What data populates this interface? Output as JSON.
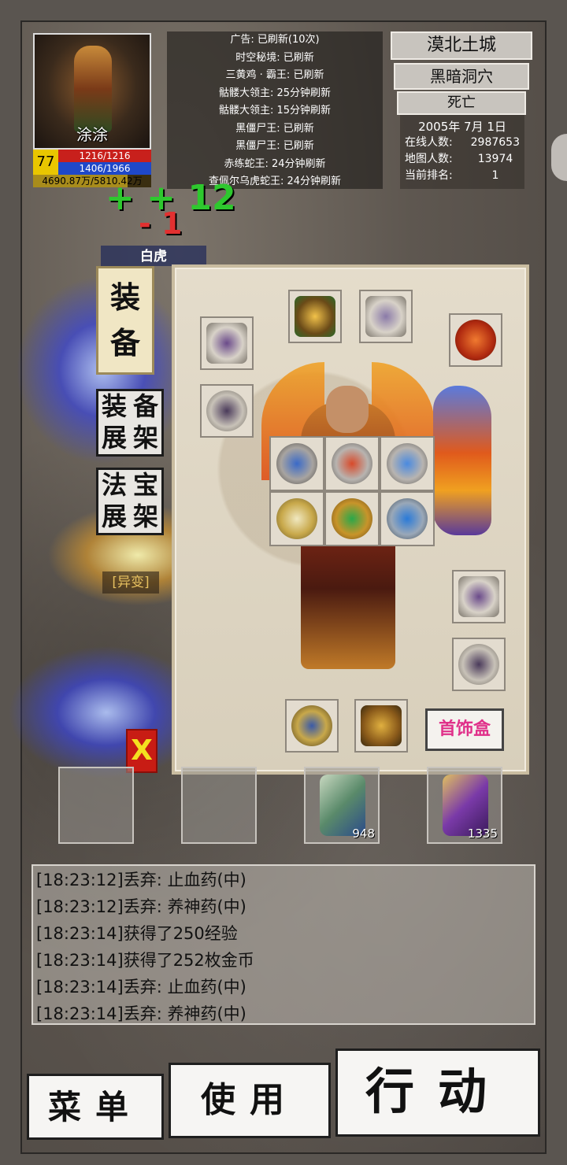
{
  "player": {
    "name": "涂涂",
    "level": "77",
    "hp": "1216/1216",
    "mp": "1406/1966",
    "exp": "4690.87万/5810.42万"
  },
  "notices": [
    "广告: 已刷新(10次)",
    "时空秘境: 已刷新",
    "三黄鸡 · 霸王: 已刷新",
    "骷髅大领主: 25分钟刷新",
    "骷髅大领主: 15分钟刷新",
    "黑僵尸王: 已刷新",
    "黑僵尸王: 已刷新",
    "赤练蛇王: 24分钟刷新",
    "查佩尔乌虎蛇王: 24分钟刷新"
  ],
  "location": {
    "region": "漠北土城",
    "map": "黑暗洞穴",
    "status": "死亡",
    "date": "2005年 7月 1日",
    "online_label": "在线人数:",
    "online_value": "2987653",
    "map_label": "地图人数:",
    "map_value": "13974",
    "rank_label": "当前排名:",
    "rank_value": "1"
  },
  "floating": {
    "heal": "+ + 12",
    "damage": "- 1"
  },
  "labels": {
    "baihu": "白虎",
    "yibian": "[异变]"
  },
  "side_tabs": {
    "equip": [
      "装",
      "备"
    ],
    "equip_rack": [
      "装",
      "备",
      "展",
      "架"
    ],
    "treasure_rack": [
      "法",
      "宝",
      "展",
      "架"
    ]
  },
  "panel": {
    "jewelry_box": "首饰盒",
    "close": "X"
  },
  "quick_slots": [
    {
      "count": ""
    },
    {
      "count": ""
    },
    {
      "count": "948"
    },
    {
      "count": "1335"
    }
  ],
  "log": [
    "[18:23:12]丢弃: 止血药(中)",
    "[18:23:12]丢弃: 养神药(中)",
    "[18:23:14]获得了250经验",
    "[18:23:14]获得了252枚金币",
    "[18:23:14]丢弃: 止血药(中)",
    "[18:23:14]丢弃: 养神药(中)"
  ],
  "buttons": {
    "menu": "菜单",
    "use": "使用",
    "action": "行动"
  },
  "colors": {
    "hp": "#c8201c",
    "mp": "#1f48c8",
    "level_bg": "#e9c600",
    "jewelry_text": "#e0308a",
    "close_bg": "#c81c14"
  }
}
